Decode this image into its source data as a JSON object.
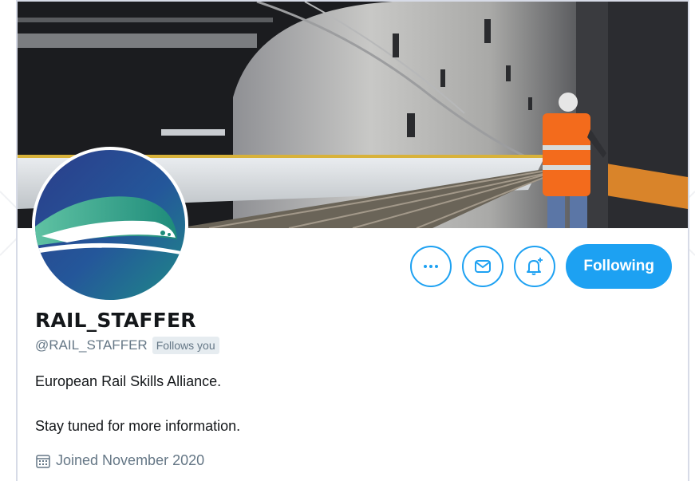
{
  "profile": {
    "display_name": "RAIL_STAFFER",
    "handle": "@RAIL_STAFFER",
    "follows_you": "Follows you",
    "bio_line1": "European Rail Skills Alliance.",
    "bio_line2": "Stay tuned for more information.",
    "joined": "Joined November 2020"
  },
  "actions": {
    "more_icon": "more-icon",
    "message_icon": "envelope-icon",
    "notify_icon": "bell-plus-icon",
    "follow_label": "Following"
  },
  "colors": {
    "accent": "#1da1f2",
    "secondary_text": "#657786",
    "primary_text": "#14171a"
  }
}
